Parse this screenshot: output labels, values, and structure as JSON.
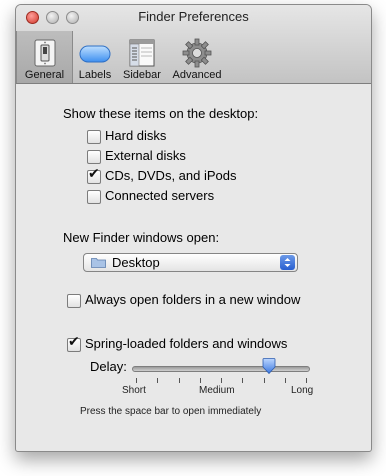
{
  "window": {
    "title": "Finder Preferences"
  },
  "toolbar": {
    "tabs": [
      {
        "label": "General",
        "icon": "light-switch-icon",
        "selected": true
      },
      {
        "label": "Labels",
        "icon": "label-icon",
        "selected": false
      },
      {
        "label": "Sidebar",
        "icon": "sidebar-icon",
        "selected": false
      },
      {
        "label": "Advanced",
        "icon": "gear-icon",
        "selected": false
      }
    ]
  },
  "desktop_items": {
    "heading": "Show these items on the desktop:",
    "options": [
      {
        "label": "Hard disks",
        "checked": false
      },
      {
        "label": "External disks",
        "checked": false
      },
      {
        "label": "CDs, DVDs, and iPods",
        "checked": true
      },
      {
        "label": "Connected servers",
        "checked": false
      }
    ]
  },
  "new_window": {
    "heading": "New Finder windows open:",
    "selected": "Desktop"
  },
  "always_open": {
    "label": "Always open folders in a new window",
    "checked": false
  },
  "spring_loaded": {
    "label": "Spring-loaded folders and windows",
    "checked": true,
    "delay_label": "Delay:",
    "delay_value": 0.8,
    "ticks": [
      "Short",
      "Medium",
      "Long"
    ],
    "hint": "Press the space bar to open immediately"
  },
  "colors": {
    "accent": "#2a5fd0",
    "window_bg": "#e8e8e8",
    "close": "#d0382b"
  }
}
